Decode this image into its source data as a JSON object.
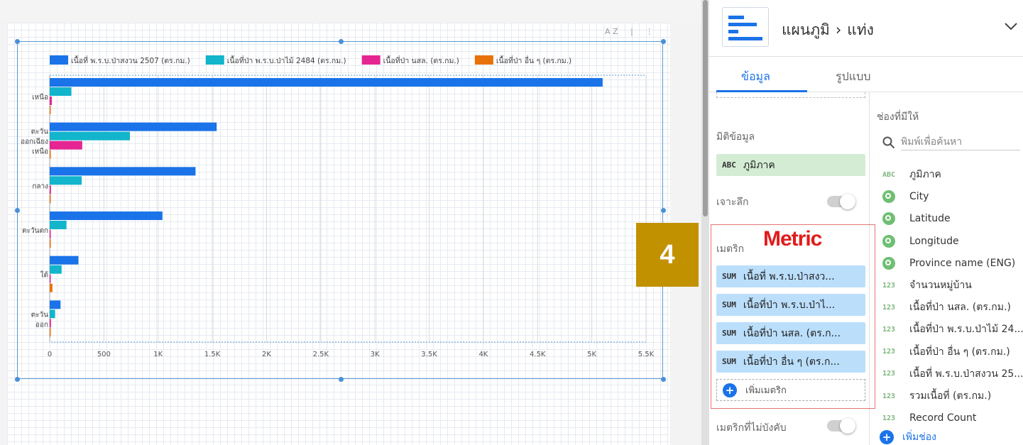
{
  "toolbar": {
    "sort_icon_label": "A Z",
    "menu_icon": "more-vert-icon"
  },
  "chart_data": {
    "type": "bar",
    "orientation": "horizontal",
    "categories": [
      "เหนือ",
      "ตะวันออกเฉียงเหนือ",
      "กลาง",
      "ตะวันตก",
      "ใต้",
      "ตะวันออก"
    ],
    "category_label_lines": [
      [
        "เหนือ"
      ],
      [
        "ตะวัน",
        "ออกเฉียง",
        "เหนือ"
      ],
      [
        "กลาง"
      ],
      [
        "ตะวันตก"
      ],
      [
        "ใต้"
      ],
      [
        "ตะวัน",
        "ออก"
      ]
    ],
    "series": [
      {
        "name": "เนื้อที่ พ.ร.บ.ป่าสงวน 2507 (ตร.กม.)",
        "color": "#1a73e8",
        "values": [
          5100,
          1540,
          1345,
          1040,
          265,
          100
        ]
      },
      {
        "name": "เนื้อที่ป่า พ.ร.บ.ป่าไม้ 2484 (ตร.กม.)",
        "color": "#12b5cb",
        "values": [
          200,
          740,
          295,
          155,
          110,
          50
        ]
      },
      {
        "name": "เนื้อที่ป่า นสล. (ตร.กม.)",
        "color": "#e52592",
        "values": [
          20,
          300,
          12,
          10,
          6,
          12
        ]
      },
      {
        "name": "เนื้อที่ป่า อื่น ๆ (ตร.กม.)",
        "color": "#e8710a",
        "values": [
          4,
          10,
          5,
          8,
          25,
          4
        ]
      }
    ],
    "xticks": [
      "0",
      "500",
      "1K",
      "1.5K",
      "2K",
      "2.5K",
      "3K",
      "3.5K",
      "4K",
      "4.5K",
      "5K",
      "5.5K"
    ],
    "xlim": [
      0,
      5500
    ],
    "legend_position": "top",
    "grid": true
  },
  "panel": {
    "breadcrumb": [
      "แผนภูมิ",
      "›",
      "แท่ง"
    ],
    "tabs": {
      "data": "ข้อมูล",
      "style": "รูปแบบ"
    },
    "dimension_label": "มิติข้อมูล",
    "dimension_chip": {
      "tag": "ABC",
      "label": "ภูมิภาค"
    },
    "drill_label": "เจาะลึก",
    "metric_label": "เมตริก",
    "metric_annotation": "Metric",
    "metrics": [
      {
        "tag": "SUM",
        "label": "เนื้อที่ พ.ร.บ.ป่าสงว..."
      },
      {
        "tag": "SUM",
        "label": "เนื้อที่ป่า พ.ร.บ.ป่าไ..."
      },
      {
        "tag": "SUM",
        "label": "เนื้อที่ป่า นสล. (ตร.ก..."
      },
      {
        "tag": "SUM",
        "label": "เนื้อที่ป่า อื่น ๆ (ตร.ก..."
      }
    ],
    "add_metric": "เพิ่มเมตริก",
    "optional_metrics_label": "เมตริกที่ไม่บังคับ",
    "available_fields_label": "ช่องที่มีให้",
    "search_placeholder": "พิมพ์เพื่อค้นหา",
    "fields": [
      {
        "type": "ABC",
        "label": "ภูมิภาค"
      },
      {
        "type": "geo",
        "label": "City"
      },
      {
        "type": "geo",
        "label": "Latitude"
      },
      {
        "type": "geo",
        "label": "Longitude"
      },
      {
        "type": "geo",
        "label": "Province name (ENG)"
      },
      {
        "type": "123",
        "label": "จำนวนหมู่บ้าน"
      },
      {
        "type": "123",
        "label": "เนื้อที่ป่า นสล. (ตร.กม.)"
      },
      {
        "type": "123",
        "label": "เนื้อที่ป่า พ.ร.บ.ป่าไม้ 24..."
      },
      {
        "type": "123",
        "label": "เนื้อที่ป่า อื่น ๆ (ตร.กม.)"
      },
      {
        "type": "123",
        "label": "เนื้อที่ พ.ร.บ.ป่าสงวน 25..."
      },
      {
        "type": "123",
        "label": "รวมเนื้อที่ (ตร.กม.)"
      },
      {
        "type": "123",
        "label": "Record Count"
      }
    ],
    "add_field": "เพิ่มช่อง"
  },
  "step_badge": "4"
}
